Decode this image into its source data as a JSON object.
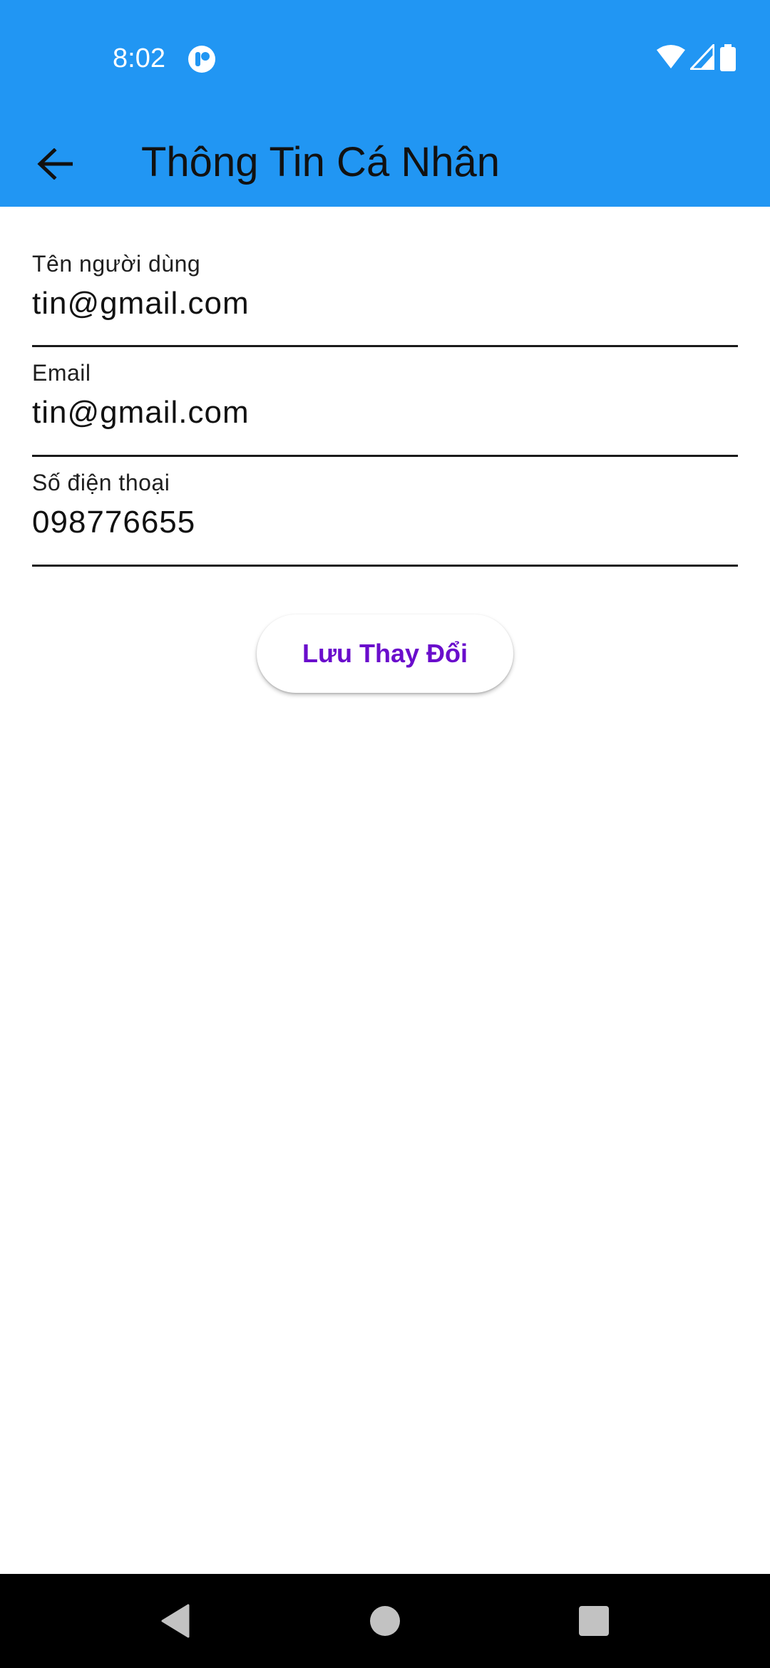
{
  "colors": {
    "appbar": "#2196F3",
    "accent": "#6A0DCC",
    "nav_bar": "#000000",
    "status_icons": "#FFFFFF"
  },
  "status_bar": {
    "time": "8:02",
    "icons": [
      "app-notification-icon",
      "wifi-icon",
      "cell-signal-icon",
      "battery-icon"
    ]
  },
  "toolbar": {
    "back_icon": "arrow-back-icon",
    "title": "Thông Tin Cá Nhân"
  },
  "form": {
    "username": {
      "label": "Tên người dùng",
      "value": "tin@gmail.com"
    },
    "email": {
      "label": "Email",
      "value": "tin@gmail.com"
    },
    "phone": {
      "label": "Số điện thoại",
      "value": "098776655"
    }
  },
  "save_button": {
    "label": "Lưu Thay Đổi"
  },
  "nav_bar": {
    "icons": [
      "back-triangle-icon",
      "home-circle-icon",
      "recents-square-icon"
    ]
  }
}
